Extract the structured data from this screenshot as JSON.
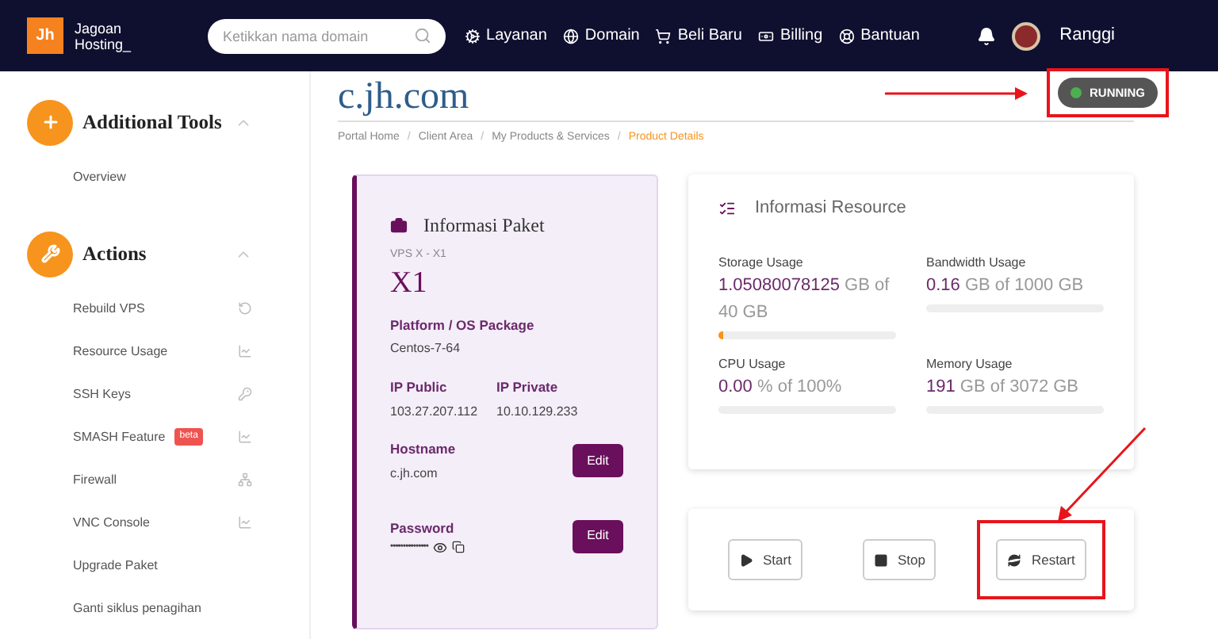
{
  "header": {
    "logo_mark": "Jh",
    "logo_text": [
      "Jagoan",
      "Hosting_"
    ],
    "search": {
      "placeholder": "Ketikkan nama domain"
    },
    "nav": [
      "Layanan",
      "Domain",
      "Beli Baru",
      "Billing",
      "Bantuan"
    ],
    "user": "Ranggi"
  },
  "sidebar": {
    "sections": [
      {
        "title": "Additional Tools",
        "items": [
          {
            "label": "Overview"
          }
        ]
      },
      {
        "title": "Actions",
        "items": [
          {
            "label": "Rebuild VPS"
          },
          {
            "label": "Resource Usage"
          },
          {
            "label": "SSH Keys"
          },
          {
            "label": "SMASH Feature",
            "badge": "beta"
          },
          {
            "label": "Firewall"
          },
          {
            "label": "VNC Console"
          },
          {
            "label": "Upgrade Paket"
          },
          {
            "label": "Ganti siklus penagihan"
          }
        ]
      }
    ]
  },
  "page": {
    "title": "c.jh.com",
    "status": "RUNNING",
    "separator": "/",
    "breadcrumb": [
      {
        "label": "Portal Home",
        "selected": false
      },
      {
        "label": "Client Area",
        "selected": false
      },
      {
        "label": "My Products & Services",
        "selected": false
      },
      {
        "label": "Product Details",
        "selected": true
      }
    ]
  },
  "package": {
    "title": "Informasi Paket",
    "subtitle": "VPS X - X1",
    "name": "X1",
    "platform_label": "Platform / OS Package",
    "platform": "Centos-7-64",
    "ip_public_label": "IP Public",
    "ip_public": "103.27.207.112",
    "ip_private_label": "IP Private",
    "ip_private": "10.10.129.233",
    "hostname_label": "Hostname",
    "hostname": "c.jh.com",
    "password_label": "Password",
    "password": "•••••••••••••••",
    "hostname_edit": "Edit",
    "password_edit": "Edit"
  },
  "resources": {
    "title": "Informasi Resource",
    "items": [
      {
        "label": "Storage Usage",
        "value": "1.05080078125",
        "rest": "GB of 40 GB",
        "level": 0.026
      },
      {
        "label": "Bandwidth Usage",
        "value": "0.16",
        "rest": "GB of 1000 GB"
      },
      {
        "label": "CPU Usage",
        "value": "0.00",
        "rest": "% of 100%"
      },
      {
        "label": "Memory Usage",
        "value": "191",
        "rest": "GB of 3072 GB"
      }
    ]
  },
  "controls": [
    {
      "label": "Start",
      "kind": "start",
      "highlighted": false
    },
    {
      "label": "Stop",
      "kind": "stop",
      "highlighted": false
    },
    {
      "label": "Restart",
      "kind": "restart",
      "highlighted": true
    }
  ]
}
